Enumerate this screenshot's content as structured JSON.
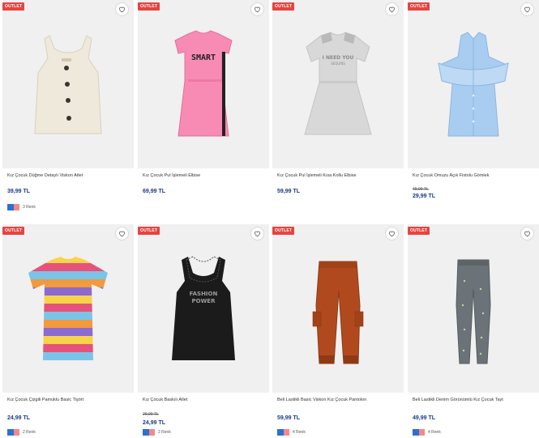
{
  "badge_label": "OUTLET",
  "accent_color": "#e8433f",
  "price_color": "#1a3a8a",
  "products": [
    {
      "name": "Kız Çocuk Düğme Detaylı Viskon Atlet",
      "price": "39,99 TL",
      "old_price": "",
      "colors": "3 Renk"
    },
    {
      "name": "Kız Çocuk Pul İşlemeli Elbise",
      "price": "69,99 TL",
      "old_price": "",
      "colors": ""
    },
    {
      "name": "Kız Çocuk Pul İşlemeli Kısa Kollu Elbise",
      "price": "59,99 TL",
      "old_price": "",
      "colors": ""
    },
    {
      "name": "Kız Çocuk Omuzu Açık Fistolu Gömlek",
      "price": "29,99 TL",
      "old_price": "49,99 TL",
      "colors": ""
    },
    {
      "name": "Kız Çocuk Çizgili Pamuklu Basic Tişört",
      "price": "24,99 TL",
      "old_price": "",
      "colors": "2 Renk"
    },
    {
      "name": "Kız Çocuk Baskılı Atlet",
      "price": "24,99 TL",
      "old_price": "29,99 TL",
      "colors": "2 Renk"
    },
    {
      "name": "Beli Lastikli Basic Viskon Kız Çocuk Pantolon",
      "price": "59,99 TL",
      "old_price": "",
      "colors": "4 Renk"
    },
    {
      "name": "Beli Lastikli Denim Görünümlü Kız Çocuk Tayt",
      "price": "49,99 TL",
      "old_price": "",
      "colors": "4 Renk"
    }
  ],
  "prints": {
    "smart": "SMART",
    "sequin": "I NEED YOU",
    "sequin_sub": "SEQUINS",
    "fashion": "FASHION",
    "fashion_sub": "POWER"
  }
}
